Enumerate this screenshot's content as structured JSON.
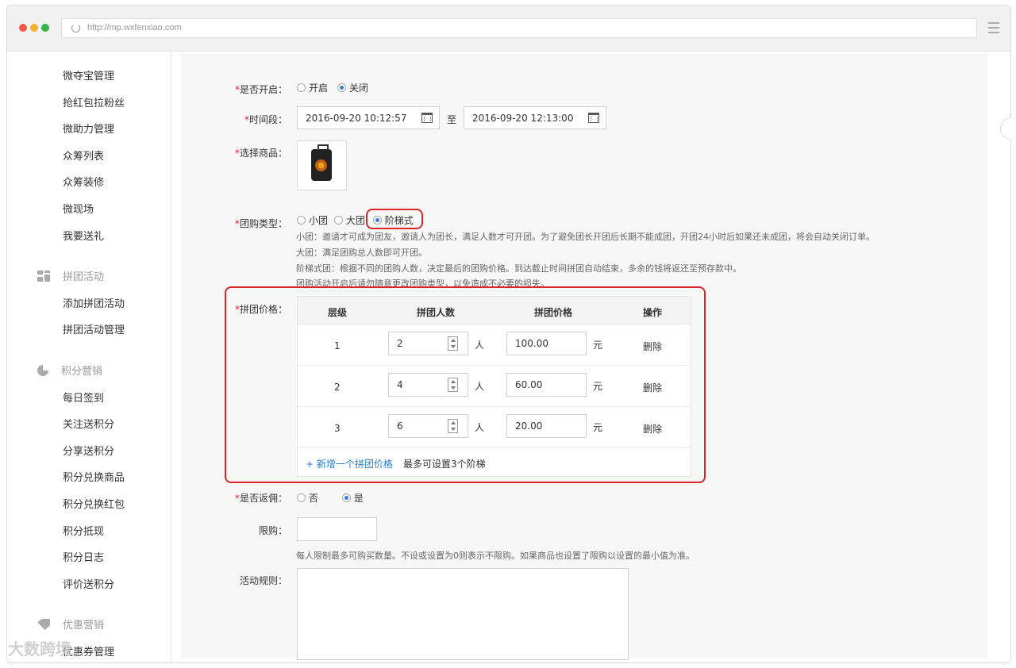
{
  "browser": {
    "url": "http://mp.wxfenxiao.com"
  },
  "sidebar": {
    "items_top": [
      "微夺宝管理",
      "抢红包拉粉丝",
      "微助力管理",
      "众筹列表",
      "众筹装修",
      "微现场",
      "我要送礼"
    ],
    "group_pintuan": {
      "label": "拼团活动",
      "icon": "grid-icon",
      "items": [
        "添加拼团活动",
        "拼团活动管理"
      ]
    },
    "group_points": {
      "label": "积分营销",
      "icon": "pie-chart-icon",
      "items": [
        "每日签到",
        "关注送积分",
        "分享送积分",
        "积分兑换商品",
        "积分兑换红包",
        "积分抵现",
        "积分日志",
        "评价送积分"
      ]
    },
    "group_coupon": {
      "label": "优惠营销",
      "icon": "tag-icon",
      "items": [
        "优惠券管理"
      ]
    }
  },
  "form": {
    "enable": {
      "label": "是否开启：",
      "options": [
        "开启",
        "关闭"
      ],
      "selected": "关闭"
    },
    "time": {
      "label": "时间段：",
      "start": "2016-09-20 10:12:57",
      "sep": "至",
      "end": "2016-09-20 12:13:00"
    },
    "product": {
      "label": "选择商品："
    },
    "group_type": {
      "label": "团购类型：",
      "options": [
        "小团",
        "大团",
        "阶梯式"
      ],
      "selected": "阶梯式",
      "help": [
        "小团：邀请才可成为团友，邀请人为团长，满足人数才可开团。为了避免团长开团后长期不能成团，开团24小时后如果还未成团，将会自动关闭订单。",
        "大团：满足团购总人数即可开团。",
        "阶梯式团：根据不同的团购人数，决定最后的团购价格。到达截止时间拼团自动结束，多余的钱将返还至预存款中。",
        "团购活动开启后请勿随意更改团购类型，以免造成不必要的损失。"
      ]
    },
    "tier_price": {
      "label": "拼团价格：",
      "headers": [
        "层级",
        "拼团人数",
        "拼团价格",
        "操作"
      ],
      "rows": [
        {
          "level": "1",
          "people": "2",
          "people_unit": "人",
          "price": "100.00",
          "price_unit": "元",
          "action": "删除"
        },
        {
          "level": "2",
          "people": "4",
          "people_unit": "人",
          "price": "60.00",
          "price_unit": "元",
          "action": "删除"
        },
        {
          "level": "3",
          "people": "6",
          "people_unit": "人",
          "price": "20.00",
          "price_unit": "元",
          "action": "删除"
        }
      ],
      "add_link": "+ 新增一个拼团价格",
      "note": "最多可设置3个阶梯"
    },
    "commission": {
      "label": "是否返佣：",
      "options": [
        "否",
        "是"
      ],
      "selected": "是"
    },
    "limit": {
      "label": "限购：",
      "value": "",
      "help": "每人限制最多可购买数量。不设或设置为0则表示不限购。如果商品也设置了限购以设置的最小值为准。"
    },
    "rules": {
      "label": "活动规则：",
      "value": ""
    }
  },
  "colors": {
    "highlight": "#d6262a",
    "link": "#2a7fc9",
    "radio_on": "#3a7bd5",
    "required": "#e02020"
  },
  "watermark": "大数跨境"
}
